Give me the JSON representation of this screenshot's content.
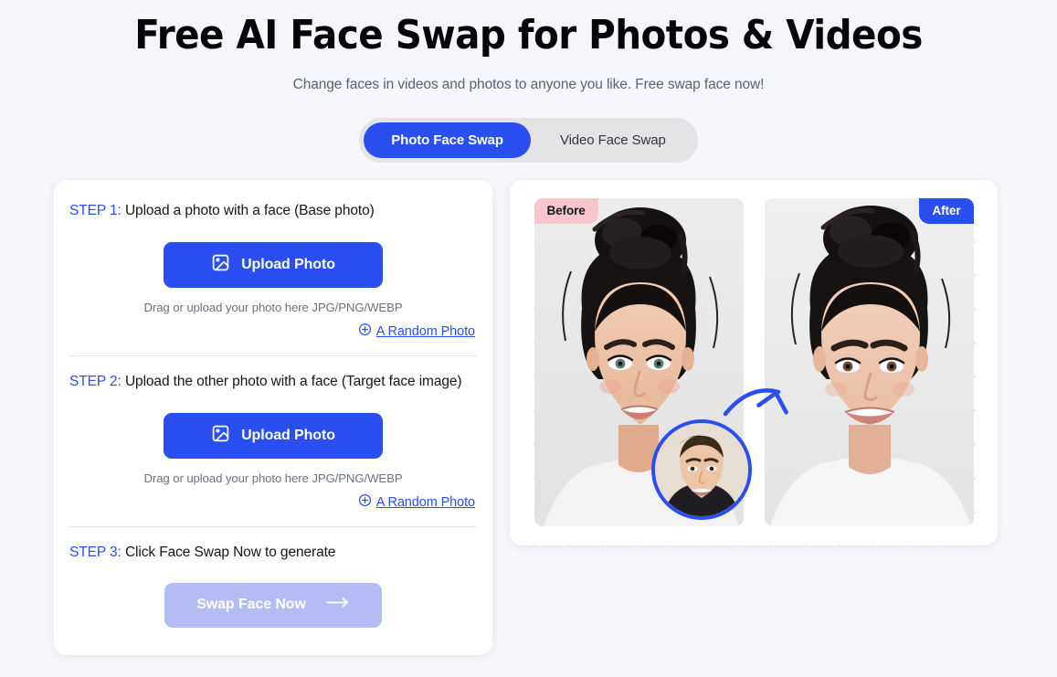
{
  "hero": {
    "title": "Free AI Face Swap for Photos & Videos",
    "subtitle": "Change faces in videos and photos to anyone you like. Free swap face now!"
  },
  "tabs": {
    "items": [
      {
        "label": "Photo Face Swap",
        "active": true
      },
      {
        "label": "Video Face Swap",
        "active": false
      }
    ]
  },
  "steps": {
    "step1": {
      "number": "STEP 1:",
      "text": " Upload a photo with a face (Base photo)",
      "upload_label": "Upload Photo",
      "upload_icon": "image-icon",
      "hint": "Drag or upload your photo here JPG/PNG/WEBP",
      "random_label": "A Random Photo",
      "random_icon": "plus-circle-icon"
    },
    "step2": {
      "number": "STEP 2:",
      "text": " Upload the other photo with a face (Target face image)",
      "upload_label": "Upload Photo",
      "upload_icon": "image-icon",
      "hint": "Drag or upload your photo here JPG/PNG/WEBP",
      "random_label": "A Random Photo",
      "random_icon": "plus-circle-icon"
    },
    "step3": {
      "number": "STEP 3:",
      "text": " Click Face Swap Now to generate",
      "swap_label": "Swap Face Now",
      "swap_icon": "arrow-right-icon",
      "swap_disabled": true
    }
  },
  "preview": {
    "before_badge": "Before",
    "after_badge": "After",
    "avatar_icon": "source-face-avatar",
    "arrow_icon": "curved-arrow-icon"
  },
  "colors": {
    "accent_blue": "#2a4ff0",
    "disabled_blue": "#b3bdf4",
    "before_pink": "#f6c5ce",
    "page_bg": "#f5f6fb",
    "tab_track": "#e4e4e6",
    "muted_text": "#6b7280"
  }
}
